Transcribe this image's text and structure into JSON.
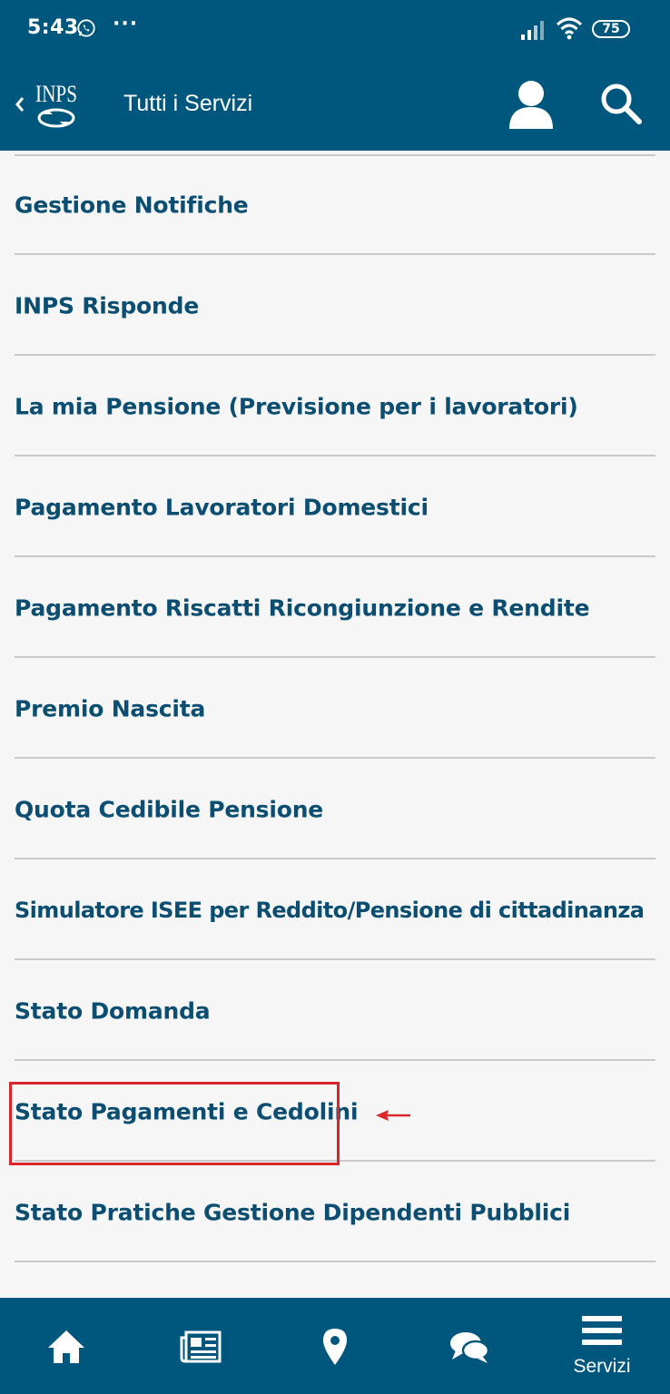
{
  "status_bar": {
    "time": "5:43",
    "more": "···",
    "battery": "75"
  },
  "app_bar": {
    "title": "Tutti i Servizi",
    "logo_text": "INPS"
  },
  "services": [
    {
      "label": "Gestione Notifiche"
    },
    {
      "label": "INPS Risponde"
    },
    {
      "label": "La mia Pensione (Previsione per i lavoratori)"
    },
    {
      "label": "Pagamento Lavoratori Domestici"
    },
    {
      "label": "Pagamento Riscatti Ricongiunzione e Rendite"
    },
    {
      "label": "Premio Nascita"
    },
    {
      "label": "Quota Cedibile Pensione"
    },
    {
      "label": "Simulatore ISEE per Reddito/Pensione di cittadinanza"
    },
    {
      "label": "Stato Domanda"
    },
    {
      "label": "Stato Pagamenti e Cedolini"
    },
    {
      "label": "Stato Pratiche Gestione Dipendenti Pubblici"
    }
  ],
  "bottom_nav": {
    "items": [
      {
        "icon": "home-icon"
      },
      {
        "icon": "news-icon"
      },
      {
        "icon": "location-pin-icon"
      },
      {
        "icon": "chat-icon"
      },
      {
        "icon": "menu-icon",
        "label": "Servizi"
      }
    ]
  },
  "colors": {
    "brand": "#00577d",
    "item_text": "#0b4e72",
    "annotation": "#d9262b"
  }
}
